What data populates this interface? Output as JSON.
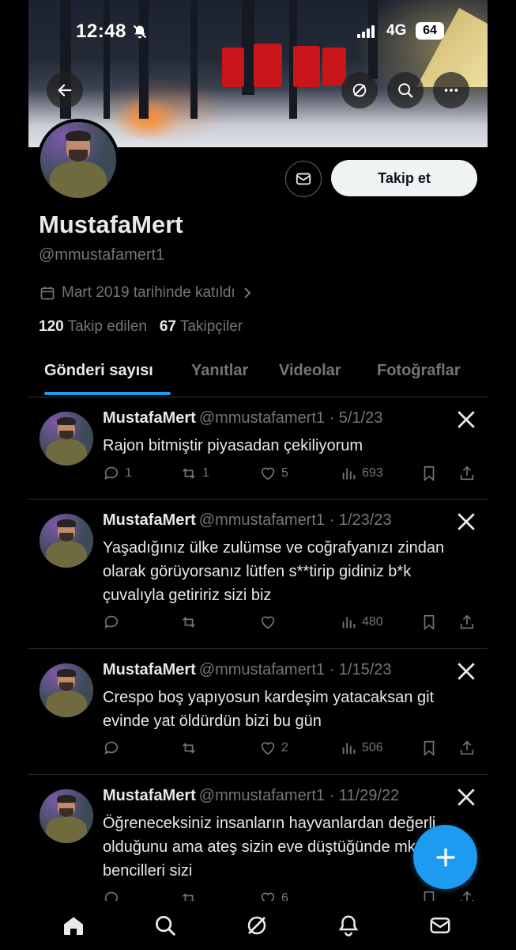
{
  "status_bar": {
    "time": "12:48",
    "network": "4G",
    "battery": "64"
  },
  "profile": {
    "name": "MustafaMert",
    "handle": "@mmustafamert1",
    "joined": "Mart 2019 tarihinde katıldı",
    "following_count": "120",
    "following_label": "Takip edilen",
    "followers_count": "67",
    "followers_label": "Takipçiler",
    "follow_label": "Takip et"
  },
  "tabs": [
    {
      "label": "Gönderi sayısı",
      "active": true
    },
    {
      "label": "Yanıtlar",
      "active": false
    },
    {
      "label": "Videolar",
      "active": false
    },
    {
      "label": "Fotoğraflar",
      "active": false
    }
  ],
  "posts": [
    {
      "name": "MustafaMert",
      "meta": "@mmustafamert1 · 5/1/23",
      "text": "Rajon bitmiştir piyasadan çekiliyorum",
      "replies": "1",
      "reposts": "1",
      "likes": "5",
      "views": "693"
    },
    {
      "name": "MustafaMert",
      "meta": "@mmustafamert1 · 1/23/23",
      "text": "Yaşadığınız ülke zulümse ve coğrafyanızı zindan olarak görüyorsanız lütfen s**tirip gidiniz b*k çuvalıyla getiririz sizi biz",
      "replies": "",
      "reposts": "",
      "likes": "",
      "views": "480"
    },
    {
      "name": "MustafaMert",
      "meta": "@mmustafamert1 · 1/15/23",
      "text": "Crespo boş yapıyosun kardeşim yatacaksan git evinde yat öldürdün bizi bu gün",
      "replies": "",
      "reposts": "",
      "likes": "2",
      "views": "506"
    },
    {
      "name": "MustafaMert",
      "meta": "@mmustafamert1 · 11/29/22",
      "text": "Öğreneceksiniz insanların hayvanlardan değerli olduğunu ama ateş sizin eve düştüğünde mk bencilleri sizi",
      "replies": "",
      "reposts": "",
      "likes": "6",
      "views": ""
    }
  ],
  "icons": {
    "back": "arrow-left-icon",
    "grok": "grok-icon",
    "search": "search-icon",
    "more": "more-icon",
    "message": "mail-icon",
    "calendar": "calendar-icon",
    "compose": "plus-icon",
    "nav": [
      "home-icon",
      "search-icon",
      "grok-icon",
      "bell-icon",
      "mail-icon"
    ]
  },
  "colors": {
    "accent": "#1d9bf0",
    "muted": "#71767b",
    "text": "#e7e9ea",
    "border": "#2f3336"
  }
}
